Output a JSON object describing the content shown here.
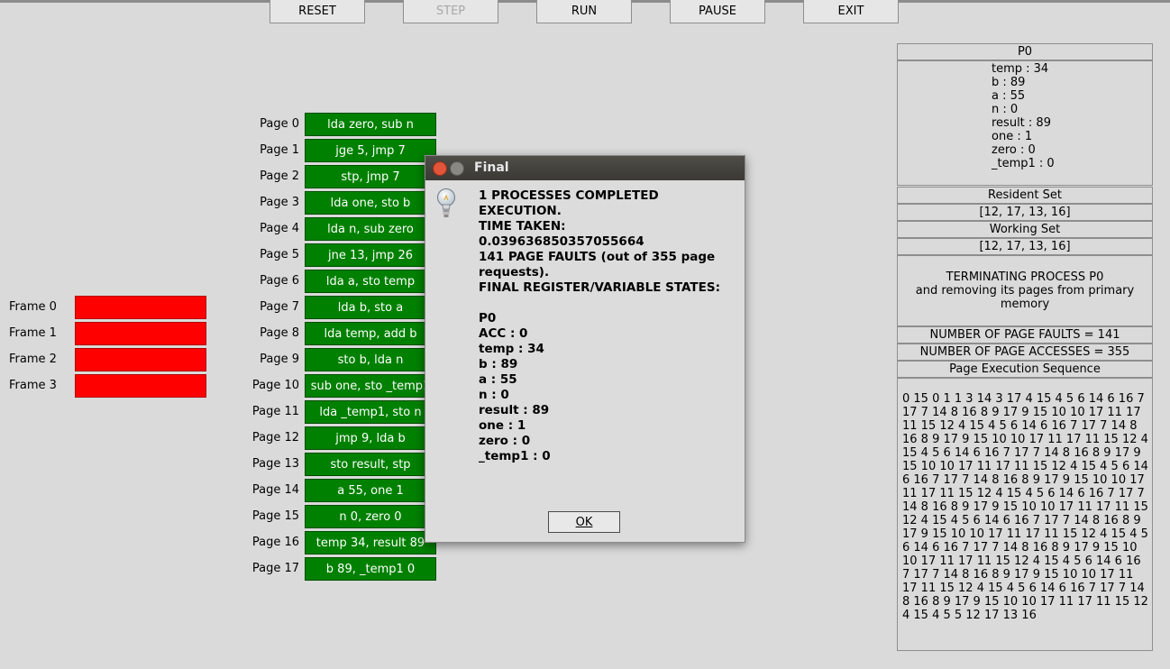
{
  "toolbar": {
    "buttons": [
      {
        "label": "RESET",
        "enabled": true
      },
      {
        "label": "STEP",
        "enabled": false
      },
      {
        "label": "RUN",
        "enabled": true
      },
      {
        "label": "PAUSE",
        "enabled": true
      },
      {
        "label": "EXIT",
        "enabled": true
      }
    ]
  },
  "frames": [
    {
      "label": "Frame 0",
      "color": "#ff0000"
    },
    {
      "label": "Frame 1",
      "color": "#ff0000"
    },
    {
      "label": "Frame 2",
      "color": "#ff0000"
    },
    {
      "label": "Frame 3",
      "color": "#ff0000"
    }
  ],
  "pages": [
    {
      "label": "Page 0",
      "content": "lda zero, sub n"
    },
    {
      "label": "Page 1",
      "content": "jge 5, jmp 7"
    },
    {
      "label": "Page 2",
      "content": "stp, jmp 7"
    },
    {
      "label": "Page 3",
      "content": "lda one, sto b"
    },
    {
      "label": "Page 4",
      "content": "lda n, sub zero"
    },
    {
      "label": "Page 5",
      "content": "jne 13, jmp 26"
    },
    {
      "label": "Page 6",
      "content": "lda a, sto temp"
    },
    {
      "label": "Page 7",
      "content": "lda b, sto a"
    },
    {
      "label": "Page 8",
      "content": "lda temp, add b"
    },
    {
      "label": "Page 9",
      "content": "sto b, lda n"
    },
    {
      "label": "Page 10",
      "content": "sub one, sto _temp1"
    },
    {
      "label": "Page 11",
      "content": "lda _temp1, sto n"
    },
    {
      "label": "Page 12",
      "content": "jmp 9, lda b"
    },
    {
      "label": "Page 13",
      "content": "sto result, stp"
    },
    {
      "label": "Page 14",
      "content": "a 55, one 1"
    },
    {
      "label": "Page 15",
      "content": "n 0, zero 0"
    },
    {
      "label": "Page 16",
      "content": "temp 34, result 89"
    },
    {
      "label": "Page 17",
      "content": "b 89, _temp1 0"
    }
  ],
  "right_panel": {
    "process_title": "P0",
    "variables": [
      "temp  :  34",
      "b  :  89",
      "a  :  55",
      "n  :  0",
      "result  :  89",
      "one  :  1",
      "zero  :  0",
      "_temp1  :  0"
    ],
    "resident_set_label": "Resident Set",
    "resident_set_value": "[12, 17, 13, 16]",
    "working_set_label": "Working Set",
    "working_set_value": "[12, 17, 13, 16]",
    "status_line1": "TERMINATING PROCESS P0",
    "status_line2": "and removing its pages from primary memory",
    "page_faults": "NUMBER OF PAGE FAULTS = 141",
    "page_accesses": "NUMBER OF PAGE ACCESSES = 355",
    "sequence_label": "Page Execution Sequence",
    "sequence": "0 15 0 1 1 3 14 3 17 4 15 4 5 6 14 6 16 7 17 7 14 8 16 8 9 17 9 15 10 10 17 11 17 11 15 12 4 15 4 5 6 14 6 16 7 17 7 14 8 16 8 9 17 9 15 10 10 17 11 17 11 15 12 4 15 4 5 6 14 6 16 7 17 7 14 8 16 8 9 17 9 15 10 10 17 11 17 11 15 12 4 15 4 5 6 14 6 16 7 17 7 14 8 16 8 9 17 9 15 10 10 17 11 17 11 15 12 4 15 4 5 6 14 6 16 7 17 7 14 8 16 8 9 17 9 15 10 10 17 11 17 11 15 12 4 15 4 5 6 14 6 16 7 17 7 14 8 16 8 9 17 9 15 10 10 17 11 17 11 15 12 4 15 4 5 6 14 6 16 7 17 7 14 8 16 8 9 17 9 15 10 10 17 11 17 11 15 12 4 15 4 5 6 14 6 16 7 17 7 14 8 16 8 9 17 9 15 10 10 17 11 17 11 15 12 4 15 4 5 6 14 6 16 7 17 7 14 8 16 8 9 17 9 15 10 10 17 11 17 11 15 12 4 15 4 5 5 12 17 13 16"
  },
  "dialog": {
    "title": "Final",
    "message": "1 PROCESSES COMPLETED\nEXECUTION.\nTIME TAKEN:\n0.039636850357055664\n141 PAGE FAULTS (out of 355 page\nrequests).\nFINAL REGISTER/VARIABLE STATES:\n\nP0\nACC : 0\ntemp : 34\nb : 89\na : 55\nn : 0\nresult : 89\none : 1\nzero : 0\n_temp1 : 0",
    "ok_label": "OK",
    "icon": "lightbulb-icon"
  }
}
